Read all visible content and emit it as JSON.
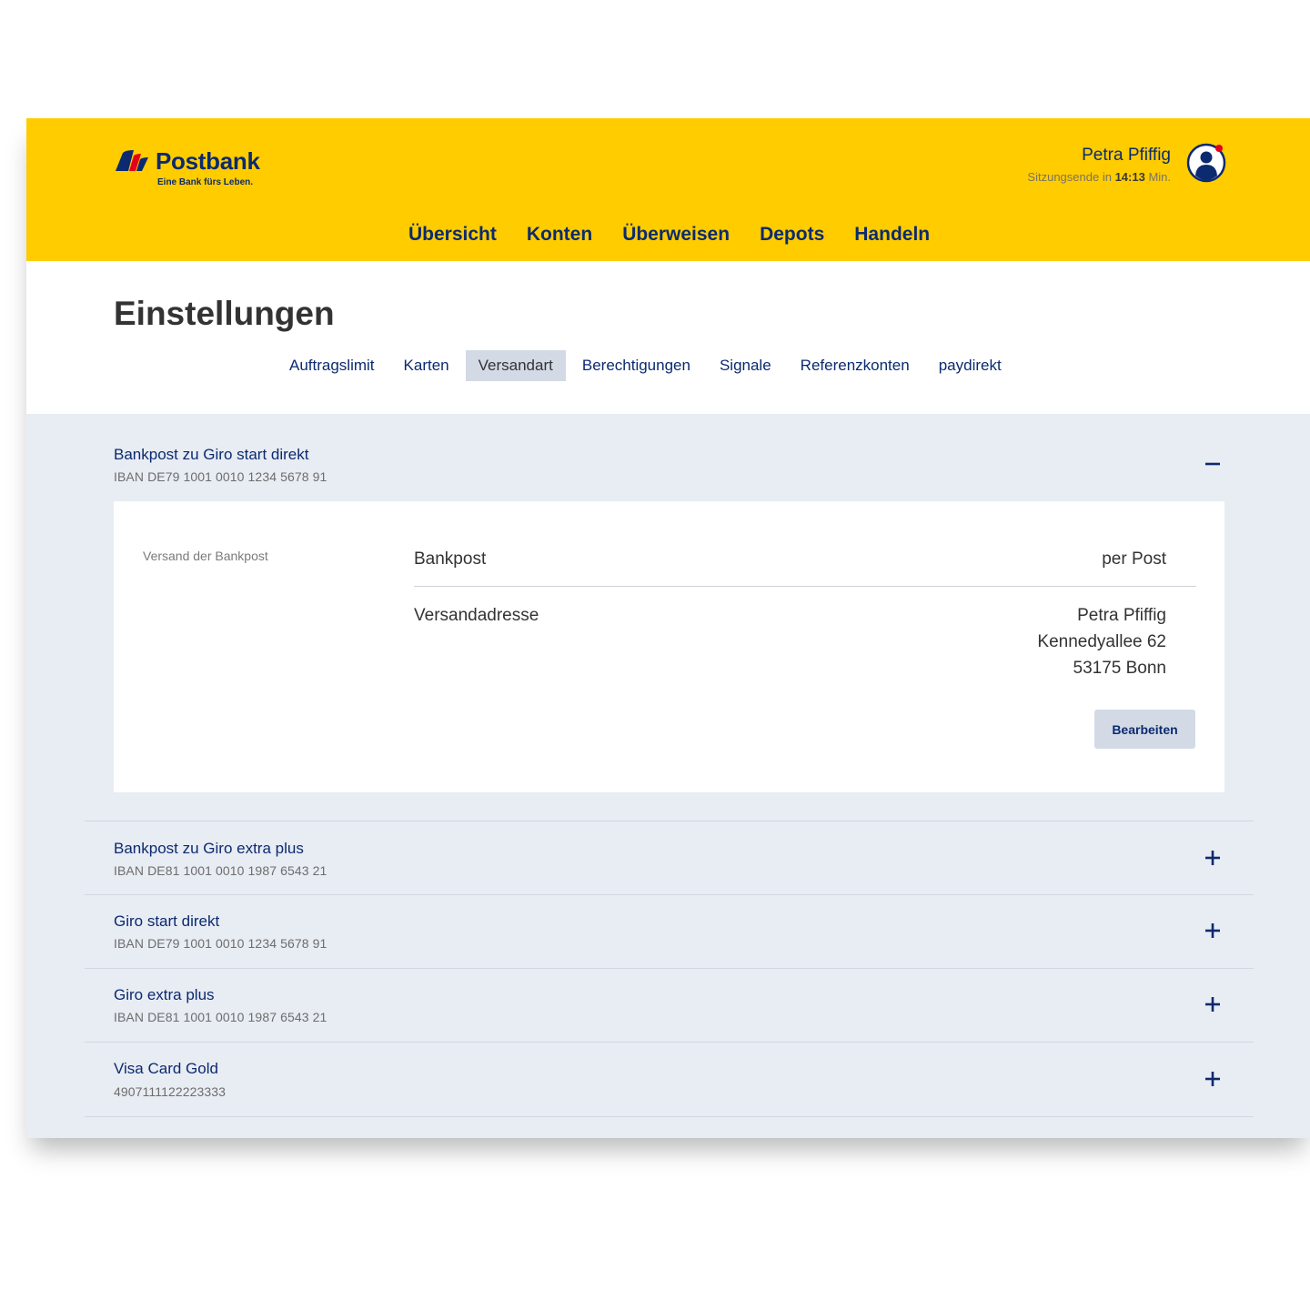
{
  "brand": {
    "name": "Postbank",
    "tagline": "Eine Bank fürs Leben."
  },
  "user": {
    "name": "Petra Pfiffig",
    "session_prefix": "Sitzungsende in",
    "session_time": "14:13",
    "session_suffix": "Min."
  },
  "main_nav": [
    "Übersicht",
    "Konten",
    "Überweisen",
    "Depots",
    "Handeln"
  ],
  "page": {
    "title": "Einstellungen"
  },
  "tabs": [
    "Auftragslimit",
    "Karten",
    "Versandart",
    "Berechtigungen",
    "Signale",
    "Referenzkonten",
    "paydirekt"
  ],
  "active_tab": "Versandart",
  "accounts": [
    {
      "title": "Bankpost zu Giro start direkt",
      "subtitle": "IBAN DE79 1001 0010 1234 5678 91",
      "expanded": true,
      "toggle": "−"
    },
    {
      "title": "Bankpost zu Giro extra plus",
      "subtitle": "IBAN DE81 1001 0010 1987 6543 21",
      "expanded": false,
      "toggle": "+"
    },
    {
      "title": "Giro start direkt",
      "subtitle": "IBAN DE79 1001 0010 1234 5678 91",
      "expanded": false,
      "toggle": "+"
    },
    {
      "title": "Giro extra plus",
      "subtitle": "IBAN DE81 1001 0010 1987 6543 21",
      "expanded": false,
      "toggle": "+"
    },
    {
      "title": "Visa Card Gold",
      "subtitle": "4907111122223333",
      "expanded": false,
      "toggle": "+"
    }
  ],
  "panel": {
    "section_label": "Versand der Bankpost",
    "bankpost_label": "Bankpost",
    "bankpost_value": "per Post",
    "address_label": "Versandadresse",
    "address_lines": [
      "Petra Pfiffig",
      "Kennedyallee 62",
      "53175 Bonn"
    ],
    "edit_button": "Bearbeiten"
  },
  "colors": {
    "header_yellow": "#ffcc00",
    "brand_blue": "#0b2a6f",
    "content_grey": "#e8ecf3",
    "tab_active": "#d3dae6",
    "logo_red": "#e3001b"
  }
}
